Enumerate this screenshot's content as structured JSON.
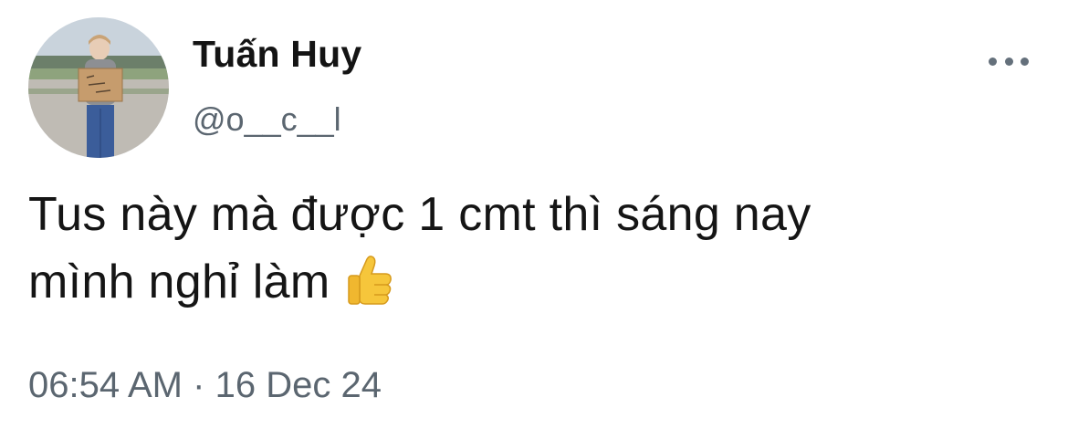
{
  "user": {
    "display_name": "Tuấn Huy",
    "handle": "@o__c__l",
    "avatar_sign_text": "HELP ME"
  },
  "tweet": {
    "text_line1": "Tus này mà được 1 cmt thì sáng nay",
    "text_line2": "mình nghỉ làm",
    "emoji": "thumbs-up-icon"
  },
  "meta": {
    "time": "06:54 AM",
    "separator": "·",
    "date": "16 Dec 24"
  },
  "menu": {
    "icon": "more-options-icon"
  },
  "colors": {
    "text": "#151515",
    "secondary": "#5b6670",
    "background": "#ffffff"
  }
}
